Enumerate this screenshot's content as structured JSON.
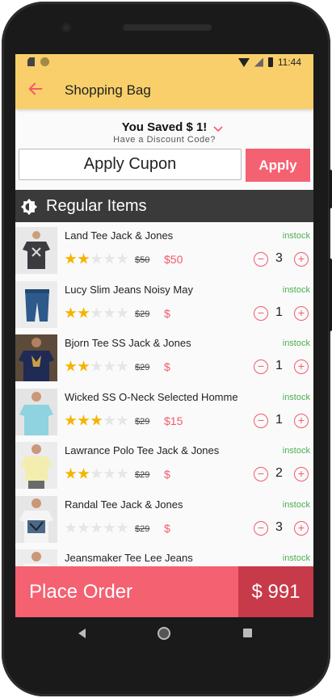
{
  "status_bar": {
    "time": "11:44"
  },
  "app_bar": {
    "title": "Shopping Bag"
  },
  "discount": {
    "saved_text": "You Saved $ 1!",
    "prompt": "Have a Discount Code?"
  },
  "coupon": {
    "input_value": "Apply Cupon",
    "apply_label": "Apply"
  },
  "section": {
    "title": "Regular Items"
  },
  "items": [
    {
      "name": "Land Tee  Jack & Jones",
      "stock": "instock",
      "rating": 2,
      "old_price": "$50",
      "new_price": "$50",
      "qty": "3"
    },
    {
      "name": "Lucy Slim Jeans Noisy May",
      "stock": "instock",
      "rating": 2,
      "old_price": "$29",
      "new_price": "$",
      "qty": "1"
    },
    {
      "name": "Bjorn Tee SS Jack & Jones",
      "stock": "instock",
      "rating": 2,
      "old_price": "$29",
      "new_price": "$",
      "qty": "1"
    },
    {
      "name": "Wicked SS O-Neck Selected Homme",
      "stock": "instock",
      "rating": 3,
      "old_price": "$29",
      "new_price": "$15",
      "qty": "1"
    },
    {
      "name": "Lawrance Polo Tee Jack & Jones",
      "stock": "instock",
      "rating": 2,
      "old_price": "$29",
      "new_price": "$",
      "qty": "2"
    },
    {
      "name": "Randal Tee Jack & Jones",
      "stock": "instock",
      "rating": 0,
      "old_price": "$29",
      "new_price": "$",
      "qty": "3"
    },
    {
      "name": "Jeansmaker Tee Lee Jeans",
      "stock": "instock",
      "rating": 0,
      "old_price": "",
      "new_price": "",
      "qty": ""
    }
  ],
  "footer": {
    "place_order_label": "Place Order",
    "total": "$ 991"
  },
  "colors": {
    "accent": "#f8cf6a",
    "primary": "#f46170",
    "total_bg": "#c73a4a",
    "instock": "#4caf50",
    "star": "#f5b400",
    "section_bg": "#3a3a3a"
  },
  "icons": {
    "back": "arrow-left-icon",
    "expand": "chevron-down-icon",
    "section": "brightness-icon",
    "minus": "minus-circle-icon",
    "plus": "plus-circle-icon"
  }
}
